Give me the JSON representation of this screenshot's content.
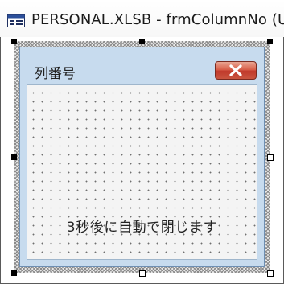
{
  "window": {
    "title": "PERSONAL.XLSB - frmColumnNo (Us",
    "icon": "userform-designer-icon"
  },
  "form": {
    "caption": "列番号",
    "close_icon": "close-icon",
    "label_text": "3秒後に自動で閉じます",
    "colors": {
      "titlebar_bg": "#c7dbee",
      "client_bg": "#f4f4f4",
      "close_button": "#c9553f"
    }
  }
}
